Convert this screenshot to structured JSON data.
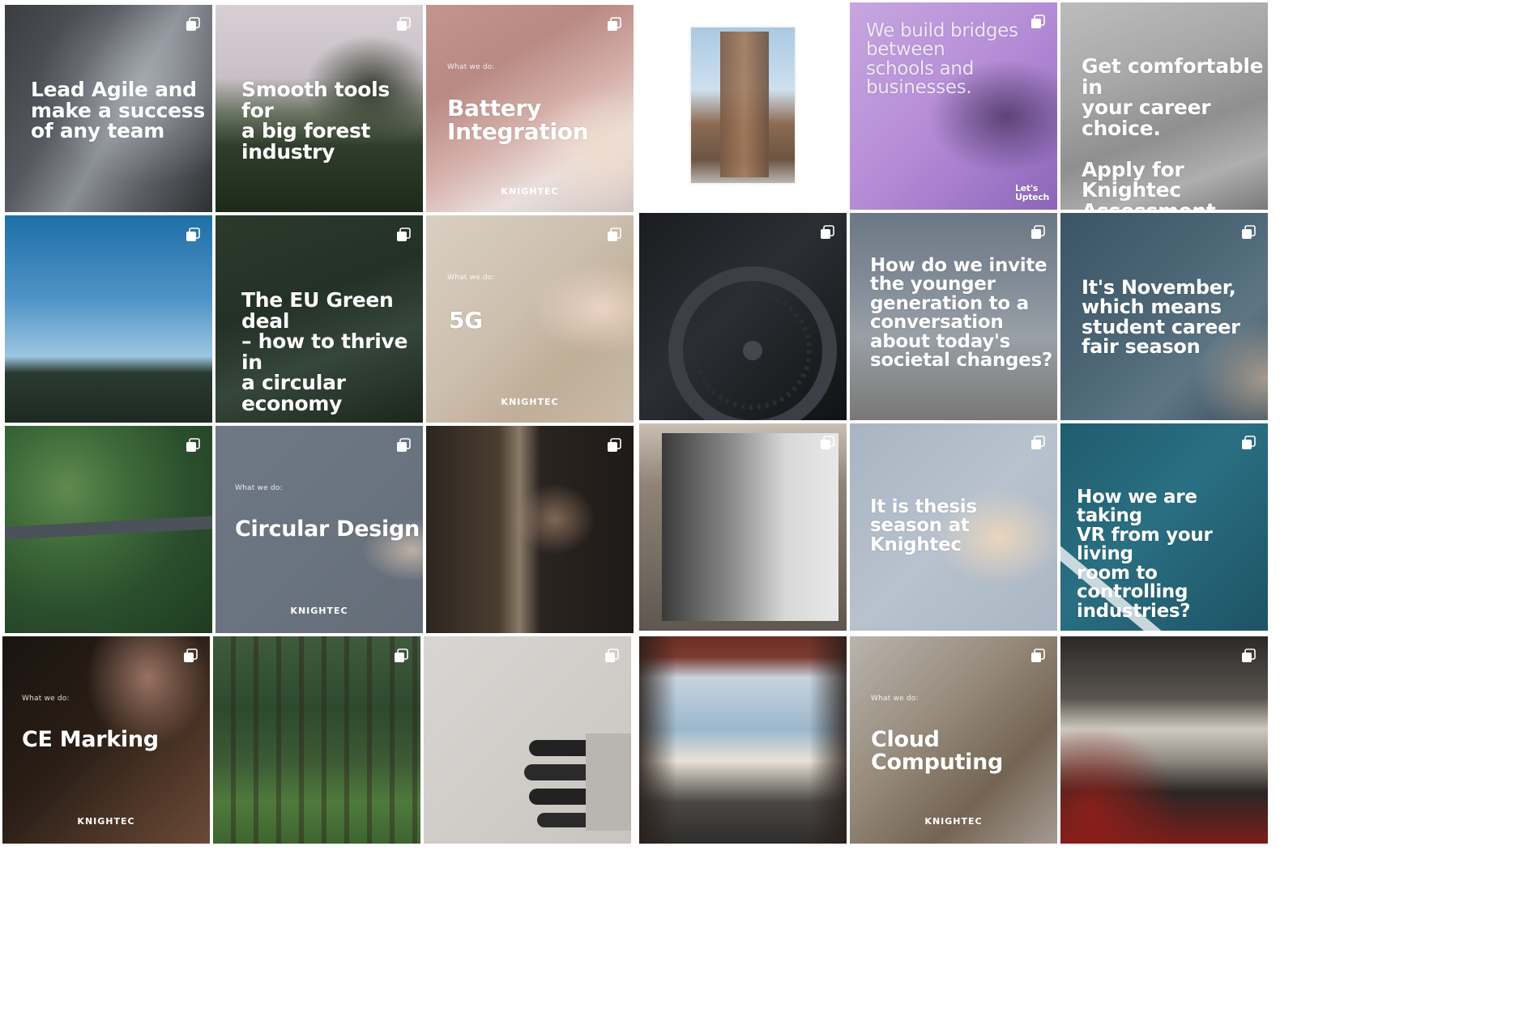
{
  "brand_mark": "KNIGHTEC",
  "kicker_text": "What we do:",
  "posts": [
    {
      "headline": "Lead Agile and\nmake a success\nof any team",
      "icon": "multiple-images-icon"
    },
    {
      "headline": "Smooth tools for\na big forest\nindustry",
      "icon": "multiple-images-icon"
    },
    {
      "kicker": "What we do:",
      "headline": "Battery Integration",
      "brand": "KNIGHTEC",
      "icon": "multiple-images-icon"
    },
    {
      "icon": "none"
    },
    {
      "headline": "We build bridges\nbetween\nschools and\nbusinesses.",
      "logo": "Let's\nUptech",
      "icon": "multiple-images-icon"
    },
    {
      "headline": "Get comfortable in\nyour career choice.\n\nApply for Knightec\nAssessment day.",
      "icon": "none"
    },
    {
      "icon": "multiple-images-icon"
    },
    {
      "headline": "The EU Green deal\n– how to thrive in\na circular economy",
      "icon": "multiple-images-icon"
    },
    {
      "kicker": "What we do:",
      "headline": "5G",
      "brand": "KNIGHTEC",
      "icon": "multiple-images-icon"
    },
    {
      "icon": "multiple-images-icon"
    },
    {
      "headline": "How do we invite\nthe younger\ngeneration to a\nconversation\nabout today's\nsocietal changes?",
      "icon": "multiple-images-icon"
    },
    {
      "headline": "It's November,\nwhich means\nstudent career\nfair season",
      "icon": "multiple-images-icon"
    },
    {
      "icon": "multiple-images-icon"
    },
    {
      "kicker": "What we do:",
      "headline": "Circular Design",
      "brand": "KNIGHTEC",
      "icon": "multiple-images-icon"
    },
    {
      "icon": "multiple-images-icon"
    },
    {
      "icon": "multiple-images-icon"
    },
    {
      "headline": "It is thesis\nseason at\nKnightec",
      "icon": "multiple-images-icon"
    },
    {
      "headline": "How we are taking\nVR from your living\nroom to controlling\nindustries?",
      "icon": "multiple-images-icon"
    },
    {
      "kicker": "What we do:",
      "headline": "CE Marking",
      "brand": "KNIGHTEC",
      "icon": "multiple-images-icon"
    },
    {
      "icon": "multiple-images-icon"
    },
    {
      "icon": "multiple-images-icon"
    },
    {
      "icon": "none"
    },
    {
      "kicker": "What we do:",
      "headline": "Cloud Computing",
      "brand": "KNIGHTEC",
      "icon": "multiple-images-icon"
    },
    {
      "icon": "multiple-images-icon"
    }
  ]
}
